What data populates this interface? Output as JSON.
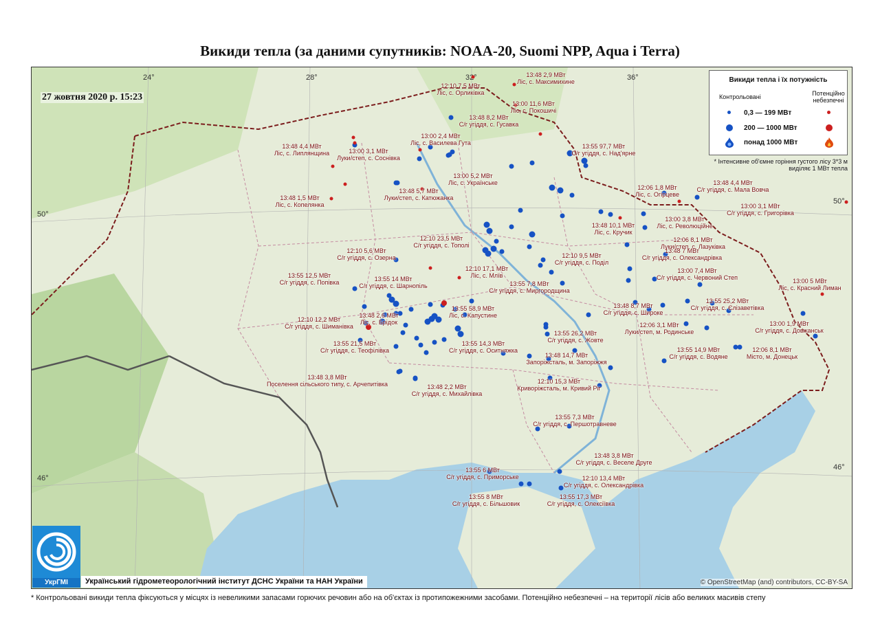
{
  "title": "Викиди тепла (за даними супутників: NOAA-20, Suomi NPP, Aqua і Terra)",
  "date": "27 жовтня 2020 р. 15:23",
  "coords": {
    "lon": [
      "24°",
      "28°",
      "32°",
      "36°"
    ],
    "lat": [
      "50°",
      "50°",
      "46°",
      "46°"
    ]
  },
  "legend": {
    "title": "Викиди тепла і їх потужність",
    "controlled": "Контрольовані",
    "dangerous": "Потенційно небезпечні",
    "rows": [
      "0,3 — 199 МВт",
      "200 — 1000 МВт",
      "понад 1000 МВт"
    ]
  },
  "note": "* Інтенсивне об'ємне горіння густого лісу 3*3 м виділяє 1 МВт тепла",
  "logo_text": "УкрГМІ",
  "institute": "Український гідрометеорологічний інститут ДСНС України та НАН України",
  "attribution": "© OpenStreetMap (and) contributors, CC-BY-SA",
  "footnote": "* Контрольовані викиди тепла фіксуються у місцях із невеликими запасами горючих речовин або на об'єктах із протипожежними засобами. Потенційно небезпечні – на території лісів або великих масивів степу",
  "colors": {
    "controlled": "#1652c4",
    "dangerous": "#cc1f1f",
    "label": "#7a0f0f",
    "sea": "#a8d0e6"
  },
  "labels": [
    {
      "l1": "12:10 7,5 МВт",
      "l2": "Ліс, с. Орликівка"
    },
    {
      "l1": "13:48 2,9 МВт",
      "l2": "Ліс, с. Максимихине"
    },
    {
      "l1": "13:00 11,6 МВт",
      "l2": "Ліс, с. Покошичі"
    },
    {
      "l1": "13:48 8,2 МВт",
      "l2": "С/г угіддя, с. Гусавка"
    },
    {
      "l1": "13:00 2,4 МВт",
      "l2": "Ліс, с. Василева Гута"
    },
    {
      "l1": "13:48 4,4 МВт",
      "l2": "Ліс, с. Липлянщина"
    },
    {
      "l1": "13:00 3,1 МВт",
      "l2": "Луки/степ, с. Соснівка"
    },
    {
      "l1": "13:55 97,7 МВт",
      "l2": "С/г угіддя, с. Над'ярне"
    },
    {
      "l1": "13:00 5,2 МВт",
      "l2": "Ліс, с. Українське"
    },
    {
      "l1": "13:48 5,7 МВт",
      "l2": "Луки/степ, с. Катюжанка"
    },
    {
      "l1": "13:48 1,5 МВт",
      "l2": "Ліс, с. Копелянка"
    },
    {
      "l1": "12:06 1,8 МВт",
      "l2": "Ліс, с. Огірцеве"
    },
    {
      "l1": "13:48 4,4 МВт",
      "l2": "С/г угіддя, с. Мала Вовча"
    },
    {
      "l1": "13:00 3,1 МВт",
      "l2": "С/г угіддя, с. Григорівка"
    },
    {
      "l1": "13:00 3,8 МВт",
      "l2": "Ліс, с. Революційне"
    },
    {
      "l1": "13:48 10,1 МВт",
      "l2": "Ліс, с. Кручик"
    },
    {
      "l1": "12:06 8,1 МВт",
      "l2": "Луки/степ, с. Лазуківка"
    },
    {
      "l1": "12:10 23,5 МВт",
      "l2": "С/г угіддя, с. Тополі"
    },
    {
      "l1": "13:48 7 МВт",
      "l2": "С/г угіддя, с. Олександрівка"
    },
    {
      "l1": "12:10 5,6 МВт",
      "l2": "С/г угіддя, с. Озерна"
    },
    {
      "l1": "12:10 9,5 МВт",
      "l2": "С/г угіддя, с. Поділ"
    },
    {
      "l1": "12:10 17,1 МВт",
      "l2": "Ліс, с. Млїв"
    },
    {
      "l1": "13:00 7,4 МВт",
      "l2": "С/г угіддя, с. Червоний Степ"
    },
    {
      "l1": "13:55 12,5 МВт",
      "l2": "С/г угіддя, с. Попівка"
    },
    {
      "l1": "13:55 14 МВт",
      "l2": "С/г угіддя, с. Шарнопіль"
    },
    {
      "l1": "13:55 7,8 МВт",
      "l2": "С/г угіддя, с. Миргородщина"
    },
    {
      "l1": "13:00 5 МВт",
      "l2": "Ліс, с. Красний Лиман"
    },
    {
      "l1": "13:55 25,2 МВт",
      "l2": "С/г угіддя, с. Єлізаветівка"
    },
    {
      "l1": "13:48 8,7 МВт",
      "l2": "С/г угіддя, с. Широке"
    },
    {
      "l1": "13:48 2,6 МВт",
      "l2": "Ліс, с. Брідок"
    },
    {
      "l1": "13:55 58,9 МВт",
      "l2": "Ліс, с. Капустине"
    },
    {
      "l1": "12:10 12,2 МВт",
      "l2": "С/г угіддя, с. Шиманівка"
    },
    {
      "l1": "12:06 3,1 МВт",
      "l2": "Луки/степ, м. Родинське"
    },
    {
      "l1": "13:00 1,9 МВт",
      "l2": "С/г угіддя, с. Довжанськ"
    },
    {
      "l1": "13:55 26,2 МВт",
      "l2": "С/г угіддя, с. Жовте"
    },
    {
      "l1": "13:55 21,5 МВт",
      "l2": "С/г угіддя, с. Теофілівка"
    },
    {
      "l1": "13:55 14,3 МВт",
      "l2": "С/г угіддя, с. Оситняжка"
    },
    {
      "l1": "13:48 14,7 МВт",
      "l2": "Запоріжсталь, м. Запоріжжя"
    },
    {
      "l1": "13:55 14,9 МВт",
      "l2": "С/г угіддя, с. Водяне"
    },
    {
      "l1": "12:06 8,1 МВт",
      "l2": "Місто, м. Донецьк"
    },
    {
      "l1": "13:48 3,8 МВт",
      "l2": "Поселення сільського типу, с. Арчепитівка"
    },
    {
      "l1": "13:48 2,2 МВт",
      "l2": "С/г угіддя, с. Михайлівка"
    },
    {
      "l1": "12:10 15,3 МВт",
      "l2": "Криворіжсталь, м. Кривий Ріг"
    },
    {
      "l1": "13:55 7,3 МВт",
      "l2": "С/г угіддя, с. Першотравневе"
    },
    {
      "l1": "13:48 3,8 МВт",
      "l2": "С/г угіддя, с. Веселе Друге"
    },
    {
      "l1": "13:55 6 МВт",
      "l2": "С/г угіддя, с. Приморське"
    },
    {
      "l1": "12:10 13,4 МВт",
      "l2": "С/г угіддя, с. Олександрівка"
    },
    {
      "l1": "13:55 8 МВт",
      "l2": "С/г угіддя, с. Більшовик"
    },
    {
      "l1": "13:55 17,3 МВт",
      "l2": "С/г угіддя, с. Олексіївка"
    }
  ]
}
